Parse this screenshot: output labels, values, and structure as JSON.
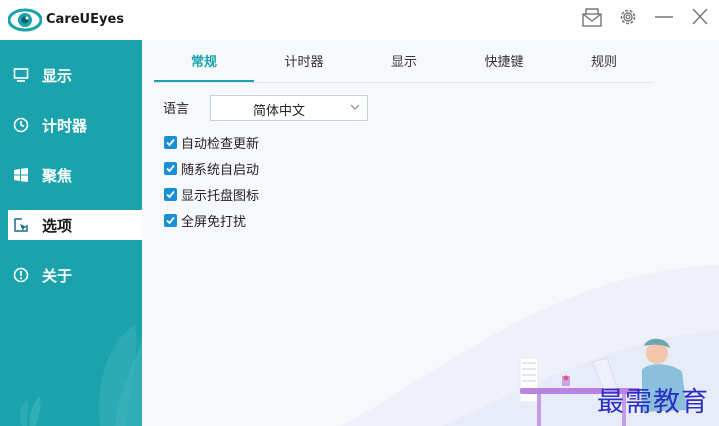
{
  "app": {
    "title": "CareUEyes"
  },
  "titlebar": {
    "icons": [
      "mail-icon",
      "gear-icon",
      "minimize-icon",
      "close-icon"
    ]
  },
  "sidebar": {
    "items": [
      {
        "label": "显示",
        "icon": "monitor-icon"
      },
      {
        "label": "计时器",
        "icon": "clock-icon"
      },
      {
        "label": "聚焦",
        "icon": "windows-icon"
      },
      {
        "label": "选项",
        "icon": "cursor-icon",
        "active": true
      },
      {
        "label": "关于",
        "icon": "info-icon"
      }
    ]
  },
  "tabs": [
    {
      "label": "常规",
      "active": true
    },
    {
      "label": "计时器"
    },
    {
      "label": "显示"
    },
    {
      "label": "快捷键"
    },
    {
      "label": "规则"
    }
  ],
  "general": {
    "language_label": "语言",
    "language_value": "简体中文",
    "options": [
      {
        "label": "自动检查更新",
        "checked": true
      },
      {
        "label": "随系统自启动",
        "checked": true
      },
      {
        "label": "显示托盘图标",
        "checked": true
      },
      {
        "label": "全屏免打扰",
        "checked": true
      }
    ]
  },
  "watermark": "最需教育",
  "colors": {
    "accent": "#1aa3ad",
    "checkbox": "#1a8fd8",
    "watermark": "#2b2fc4"
  }
}
